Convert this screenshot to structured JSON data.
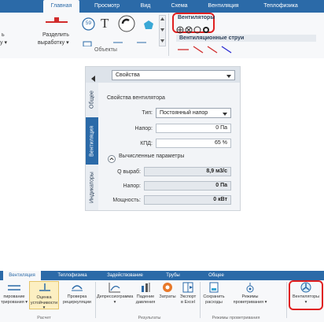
{
  "top_ribbon": {
    "tabs": [
      "Главная",
      "Просмотр",
      "Вид",
      "Схема",
      "Вентиляция",
      "Теплофизика"
    ],
    "active_tab": "Главная",
    "split_label_line1": "Разделить",
    "split_label_line2": "выработку ▾",
    "left_fragment1": "ь",
    "left_fragment2": "у ▾",
    "group_label": "Объекты",
    "node_number": "59",
    "text_tool": "T",
    "fans_gallery_title": "Вентиляторы",
    "vent_jets_title": "Вентиляционные струи",
    "highlight_color": "#e02020"
  },
  "properties_panel": {
    "header_title": "Свойства",
    "vertical_tabs": [
      "Общее",
      "Вентиляция",
      "Индикаторы"
    ],
    "active_vertical_tab": "Вентиляция",
    "section_title": "Свойства вентилятора",
    "type_label": "Тип:",
    "type_value": "Постоянный напор",
    "head_label": "Напор:",
    "head_value": "0 Па",
    "efficiency_label": "КПД:",
    "efficiency_value": "65 %",
    "computed_title": "Вычисленные параметры",
    "q_label": "Q выраб:",
    "q_value": "8,9 м3/с",
    "head2_label": "Напор:",
    "head2_value": "0 Па",
    "power_label": "Мощность:",
    "power_value": "0 кВт"
  },
  "bottom_ribbon": {
    "tabs": [
      "Вентиляция",
      "Теплофизика",
      "Задействование",
      "Трубы",
      "Общее"
    ],
    "active_tab": "Вентиляция",
    "buttons": [
      {
        "label": "пирование\nтрирования ▾"
      },
      {
        "label": "Оценка\nустойчивости ▾"
      },
      {
        "label": "Проверка\nрециркуляции"
      },
      {
        "label": "Депрессиограмма\n▾"
      },
      {
        "label": "Падение\nдавления"
      },
      {
        "label": "Затраты"
      },
      {
        "label": "Экспорт\nв Excel"
      },
      {
        "label": "Сохранить\nрасходы"
      },
      {
        "label": "Режимы\nпроветривания ▾"
      },
      {
        "label": "Вентиляторы\n▾"
      }
    ],
    "groups": [
      "Расчет",
      "Результаты",
      "Режимы проветривания"
    ],
    "accent_color": "#2b6aa8"
  }
}
